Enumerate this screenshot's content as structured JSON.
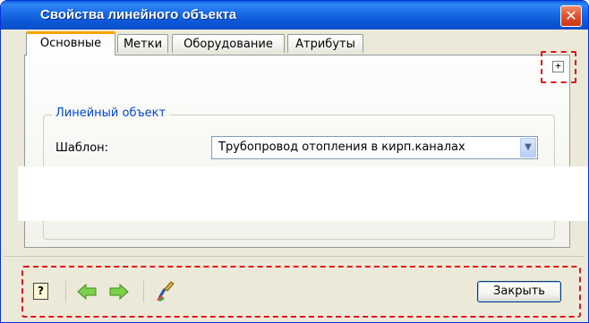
{
  "window": {
    "title": "Свойства линейного объекта",
    "close_glyph": "✕"
  },
  "tabs": [
    {
      "label": "Основные",
      "active": true
    },
    {
      "label": "Метки",
      "active": false
    },
    {
      "label": "Оборудование",
      "active": false
    },
    {
      "label": "Атрибуты",
      "active": false
    }
  ],
  "expand_button": {
    "glyph": "+",
    "icon": "plus-box-icon"
  },
  "group": {
    "legend": "Линейный объект",
    "template_label": "Шаблон:",
    "template_value": "Трубопровод отопления в кирп.каналах",
    "dropdown_glyph": "▼"
  },
  "toolbar": {
    "help_glyph": "?",
    "help_icon": "help-icon",
    "back_icon": "green-arrow-left-icon",
    "forward_icon": "green-arrow-right-icon",
    "brush_icon": "paint-brush-icon",
    "close_label": "Закрыть"
  },
  "colors": {
    "titlebar": "#0b56d6",
    "window_bg": "#ece9d8",
    "active_tab_accent": "#f7a400",
    "highlight_dashes": "#e0141e",
    "group_legend": "#0046d5"
  }
}
